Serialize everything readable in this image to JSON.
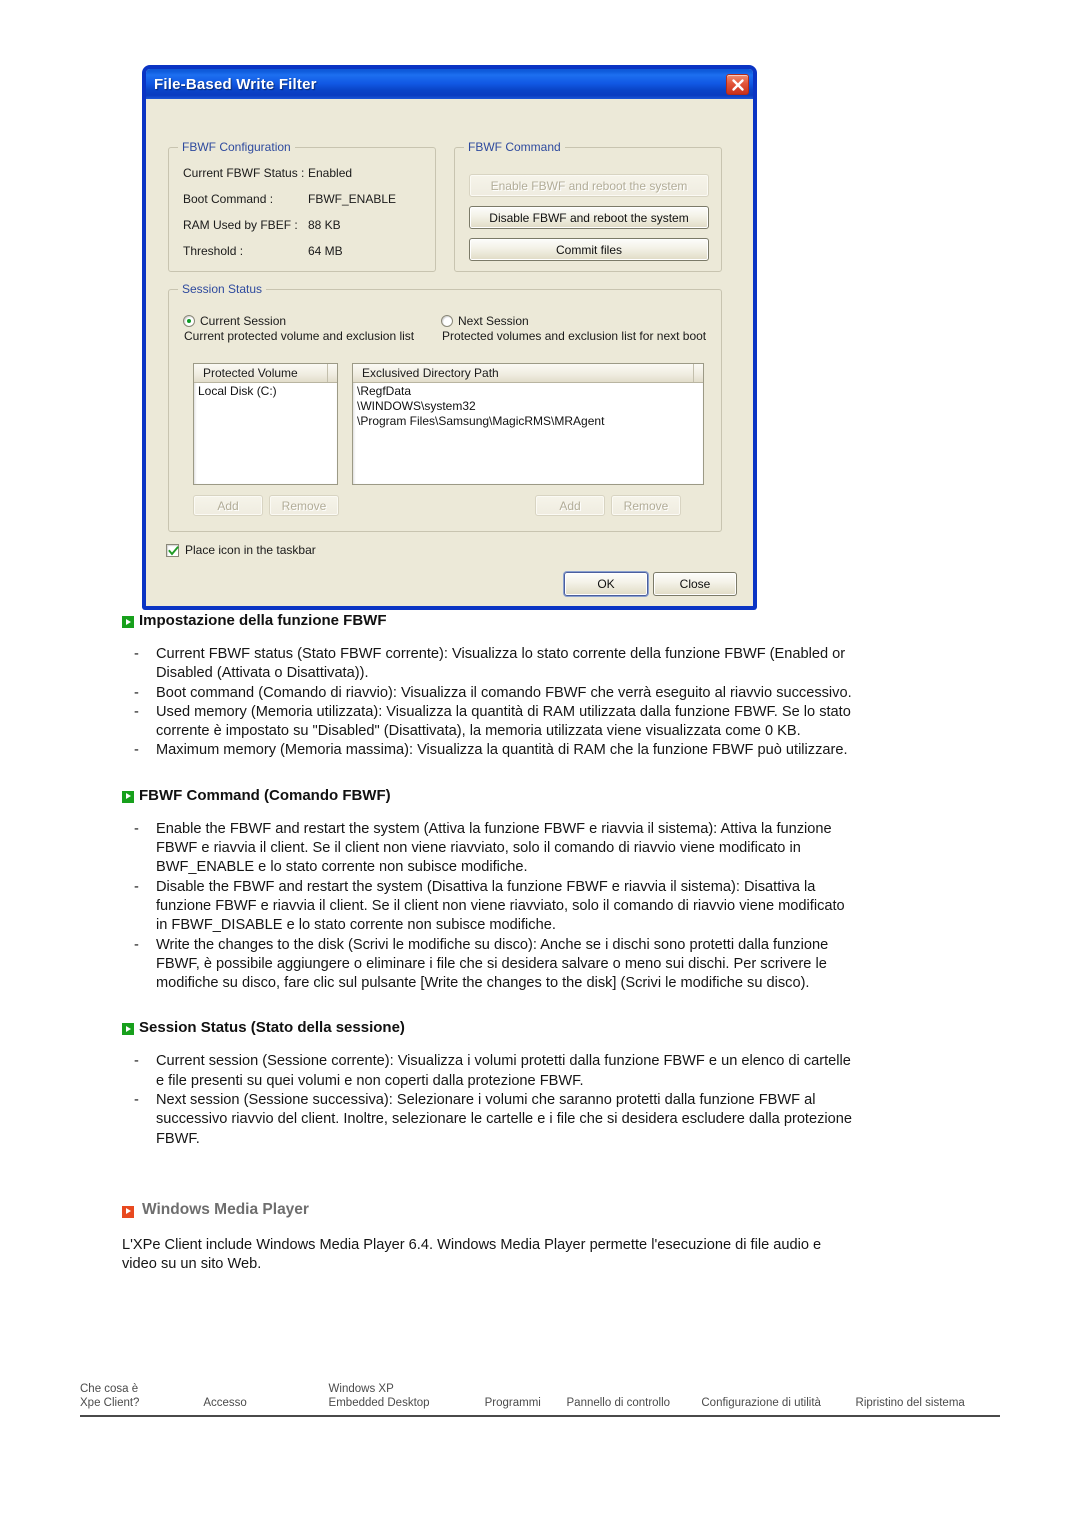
{
  "dialog": {
    "title": "File-Based Write Filter",
    "close_icon": "close-icon",
    "config_group": {
      "legend": "FBWF Configuration",
      "rows": [
        {
          "label": "Current FBWF Status :",
          "value": "Enabled"
        },
        {
          "label": "Boot Command :",
          "value": "FBWF_ENABLE"
        },
        {
          "label": "RAM Used by FBEF :",
          "value": "88 KB"
        },
        {
          "label": "Threshold :",
          "value": "64 MB"
        }
      ]
    },
    "command_group": {
      "legend": "FBWF Command",
      "enable_button": "Enable FBWF and reboot the system",
      "disable_button": "Disable FBWF and reboot the system",
      "commit_button": "Commit files"
    },
    "session_group": {
      "legend": "Session Status",
      "current_session": {
        "label": "Current Session",
        "description": "Current  protected volume and exclusion list",
        "selected": true
      },
      "next_session": {
        "label": "Next Session",
        "description": "Protected volumes and exclusion list for next boot",
        "selected": false
      },
      "volume_list": {
        "header": "Protected Volume",
        "items": [
          "Local Disk (C:)"
        ]
      },
      "path_list": {
        "header": "Exclusived Directory Path",
        "items": [
          "\\RegfData",
          "\\WINDOWS\\system32",
          "\\Program Files\\Samsung\\MagicRMS\\MRAgent"
        ]
      },
      "volume_add": "Add",
      "volume_remove": "Remove",
      "path_add": "Add",
      "path_remove": "Remove"
    },
    "taskbar_checkbox": {
      "label": "Place icon in the taskbar",
      "checked": true
    },
    "ok_button": "OK",
    "close_button": "Close"
  },
  "doc": {
    "section1": {
      "heading": "Impostazione della funzione FBWF",
      "items": [
        "Current FBWF status (Stato FBWF corrente): Visualizza lo stato corrente della funzione FBWF (Enabled or Disabled (Attivata o Disattivata)).",
        "Boot command (Comando di riavvio): Visualizza il comando FBWF che verrà eseguito al riavvio successivo.",
        "Used memory (Memoria utilizzata): Visualizza la quantità di RAM utilizzata dalla funzione FBWF. Se lo stato corrente è impostato su \"Disabled\" (Disattivata), la memoria utilizzata viene visualizzata come 0 KB.",
        "Maximum memory (Memoria massima): Visualizza la quantità di RAM che la funzione FBWF può utilizzare."
      ]
    },
    "section2": {
      "heading": "FBWF Command (Comando FBWF)",
      "items": [
        "Enable the FBWF and restart the system (Attiva la funzione FBWF e riavvia il sistema): Attiva la funzione FBWF e riavvia il client. Se il client non viene riavviato, solo il comando di riavvio viene modificato in BWF_ENABLE e lo stato corrente non subisce modifiche.",
        "Disable the FBWF and restart the system (Disattiva la funzione FBWF e riavvia il sistema): Disattiva la funzione FBWF e riavvia il client. Se il client non viene riavviato, solo il comando di riavvio viene modificato in FBWF_DISABLE e lo stato corrente non subisce modifiche.",
        "Write the changes to the disk (Scrivi le modifiche su disco): Anche se i dischi sono protetti dalla funzione FBWF, è possibile aggiungere o eliminare i file che si desidera salvare o meno sui dischi. Per scrivere le modifiche su disco, fare clic sul pulsante [Write the changes to the disk] (Scrivi le modifiche su disco)."
      ]
    },
    "section3": {
      "heading": "Session Status (Stato della sessione)",
      "items": [
        "Current session (Sessione corrente): Visualizza i volumi protetti dalla funzione FBWF e un elenco di cartelle e file presenti su quei volumi e non coperti dalla protezione FBWF.",
        "Next session (Sessione successiva): Selezionare i volumi che saranno protetti dalla funzione FBWF al successivo riavvio del client. Inoltre, selezionare le cartelle e i file che si desidera escludere dalla protezione FBWF."
      ]
    },
    "section4": {
      "heading": "Windows Media Player",
      "paragraph": "L'XPe Client include Windows Media Player 6.4. Windows Media Player permette l'esecuzione di file audio e video su un sito Web."
    },
    "dash": "-"
  },
  "footer": {
    "items": [
      "Che cosa è\nXpe Client?",
      "Accesso",
      "Windows XP\nEmbedded Desktop",
      "Programmi",
      "Pannello di controllo",
      "Configurazione di utilità",
      "Ripristino del sistema"
    ]
  }
}
